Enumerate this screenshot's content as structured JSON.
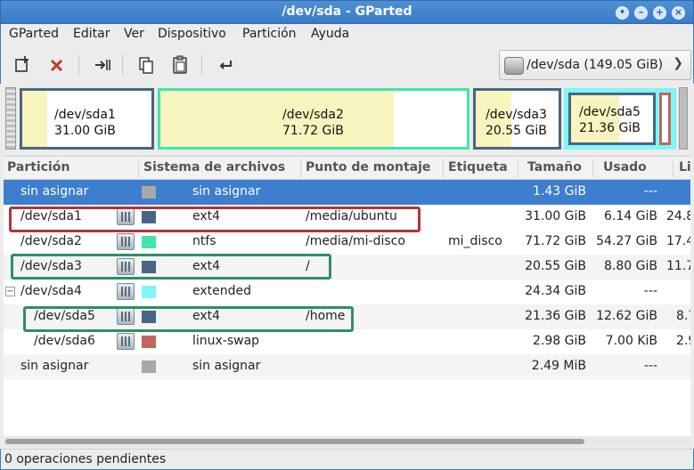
{
  "window": {
    "title": "/dev/sda - GParted"
  },
  "menu": [
    "GParted",
    "Editar",
    "Ver",
    "Dispositivo",
    "Partición",
    "Ayuda"
  ],
  "toolbar": {
    "icons": [
      "new-partition-icon",
      "delete-icon",
      "resize-move-icon",
      "copy-icon",
      "paste-icon",
      "undo-icon"
    ],
    "device": "/dev/sda  (149.05 GiB)"
  },
  "map": {
    "sda1": {
      "name": "/dev/sda1",
      "size": "31.00 GiB",
      "used_fraction": 0.198
    },
    "sda2": {
      "name": "/dev/sda2",
      "size": "71.72 GiB",
      "used_fraction": 0.757
    },
    "sda3": {
      "name": "/dev/sda3",
      "size": "20.55 GiB",
      "used_fraction": 0.428
    },
    "sda5": {
      "name": "/dev/sda5",
      "size": "21.36 GiB",
      "used_fraction": 0.591
    }
  },
  "columns": [
    "Partición",
    "Sistema de archivos",
    "Punto de montaje",
    "Etiqueta",
    "Tamaño",
    "Usado",
    "Li"
  ],
  "rows": [
    {
      "partition": "sin asignar",
      "fs": "sin asignar",
      "mount": "",
      "label": "",
      "size": "1.43 GiB",
      "used": "---",
      "unused": "",
      "color": "#a8a8a8",
      "locked": false
    },
    {
      "partition": "/dev/sda1",
      "fs": "ext4",
      "mount": "/media/ubuntu",
      "label": "",
      "size": "31.00 GiB",
      "used": "6.14 GiB",
      "unused": "24.8",
      "color": "#4a6582",
      "locked": true
    },
    {
      "partition": "/dev/sda2",
      "fs": "ntfs",
      "mount": "/media/mi-disco",
      "label": "mi_disco",
      "size": "71.72 GiB",
      "used": "54.27 GiB",
      "unused": "17.4",
      "color": "#42e5ac",
      "locked": true
    },
    {
      "partition": "/dev/sda3",
      "fs": "ext4",
      "mount": "/",
      "label": "",
      "size": "20.55 GiB",
      "used": "8.80 GiB",
      "unused": "11.7",
      "color": "#4a6582",
      "locked": true
    },
    {
      "partition": "/dev/sda4",
      "fs": "extended",
      "mount": "",
      "label": "",
      "size": "24.34 GiB",
      "used": "---",
      "unused": "",
      "color": "#7ef7f7",
      "locked": true
    },
    {
      "partition": "/dev/sda5",
      "fs": "ext4",
      "mount": "/home",
      "label": "",
      "size": "21.36 GiB",
      "used": "12.62 GiB",
      "unused": "8.7",
      "color": "#4a6582",
      "locked": true
    },
    {
      "partition": "/dev/sda6",
      "fs": "linux-swap",
      "mount": "",
      "label": "",
      "size": "2.98 GiB",
      "used": "7.00 KiB",
      "unused": "2.9",
      "color": "#c1665a",
      "locked": true
    },
    {
      "partition": "sin asignar",
      "fs": "sin asignar",
      "mount": "",
      "label": "",
      "size": "2.49 MiB",
      "used": "---",
      "unused": "",
      "color": "#a8a8a8",
      "locked": false
    }
  ],
  "status": "0 operaciones pendientes",
  "colors": {
    "selection": "#3d7ece",
    "highlight_red": "#b0343a",
    "highlight_green": "#2f8f5f"
  }
}
